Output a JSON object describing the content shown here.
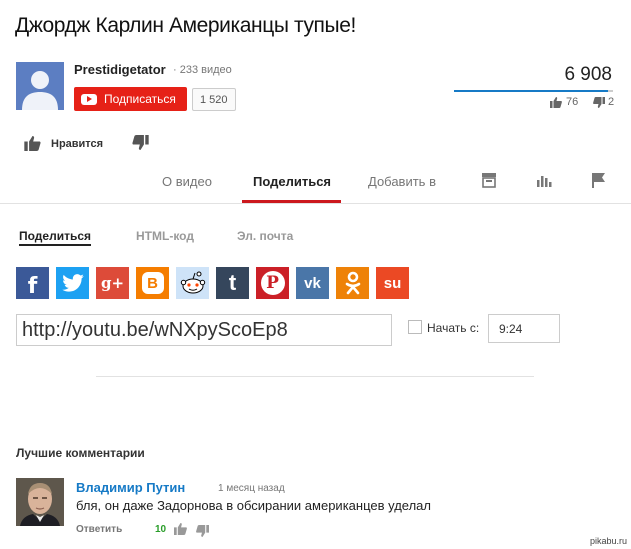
{
  "video": {
    "title": "Джордж Карлин Американцы тупые!"
  },
  "channel": {
    "name": "Prestidigetator",
    "video_count": "· 233 видео",
    "subscribe_label": "Подписаться",
    "subscribers": "1 520"
  },
  "stats": {
    "views": "6 908",
    "likes": "76",
    "dislikes": "2",
    "like_ratio": 0.97
  },
  "actions": {
    "like_label": "Нравится"
  },
  "tabs": [
    "О видео",
    "Поделиться",
    "Добавить в"
  ],
  "share": {
    "subtabs": [
      "Поделиться",
      "HTML-код",
      "Эл. почта"
    ],
    "url": "http://youtu.be/wNXpyScoEp8",
    "start_label": "Начать с:",
    "start_time": "9:24",
    "networks": [
      {
        "name": "facebook",
        "glyph": "f",
        "color": "#3b5998"
      },
      {
        "name": "twitter",
        "glyph": "t",
        "color": "#1da1f2"
      },
      {
        "name": "google-plus",
        "glyph": "g+",
        "color": "#dd4b39"
      },
      {
        "name": "blogger",
        "glyph": "B",
        "color": "#f57d00"
      },
      {
        "name": "reddit",
        "glyph": "r",
        "color": "#cee3f8"
      },
      {
        "name": "tumblr",
        "glyph": "t",
        "color": "#35465c"
      },
      {
        "name": "pinterest",
        "glyph": "P",
        "color": "#cb2027"
      },
      {
        "name": "vk",
        "glyph": "vk",
        "color": "#4a76a8"
      },
      {
        "name": "odnoklassniki",
        "glyph": "ok",
        "color": "#ee8208"
      },
      {
        "name": "stumbleupon",
        "glyph": "su",
        "color": "#eb4924"
      }
    ]
  },
  "comments": {
    "heading": "Лучшие комментарии",
    "items": [
      {
        "author": "Владимир Путин",
        "time": "1 месяц назад",
        "text": "бля, он даже Задорнова в обсирании американцев уделал",
        "reply_label": "Ответить",
        "score": "10"
      }
    ]
  },
  "watermark": {
    "site": "pikabu.ru"
  },
  "colors": {
    "accent_red": "#cc181e",
    "subscribe_red": "#e62117",
    "link_blue": "#167ac6",
    "like_green": "#2a9d2a"
  }
}
